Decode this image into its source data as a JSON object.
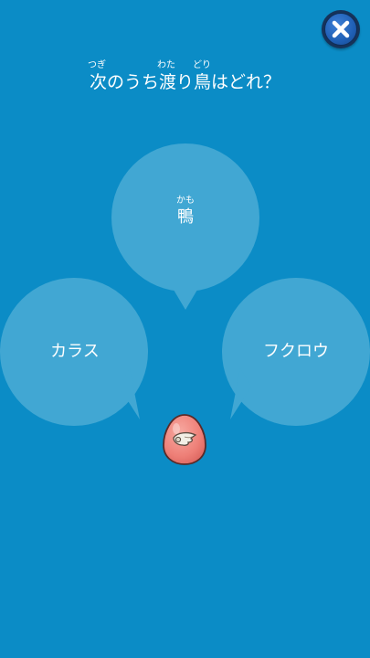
{
  "question": {
    "text": "次のうち渡り鳥はどれ？",
    "furigana": {
      "tsugi": "つぎ",
      "wata": "わた",
      "dori": "どり"
    }
  },
  "choices": [
    {
      "label": "鴨",
      "furigana": "かも"
    },
    {
      "label": "カラス"
    },
    {
      "label": "フクロウ"
    }
  ],
  "colors": {
    "background": "#0b8cc6",
    "bubble": "#41a7d3",
    "egg": "#f0877f"
  },
  "icons": {
    "close": "close-x-icon",
    "egg": "winged-egg-icon"
  }
}
